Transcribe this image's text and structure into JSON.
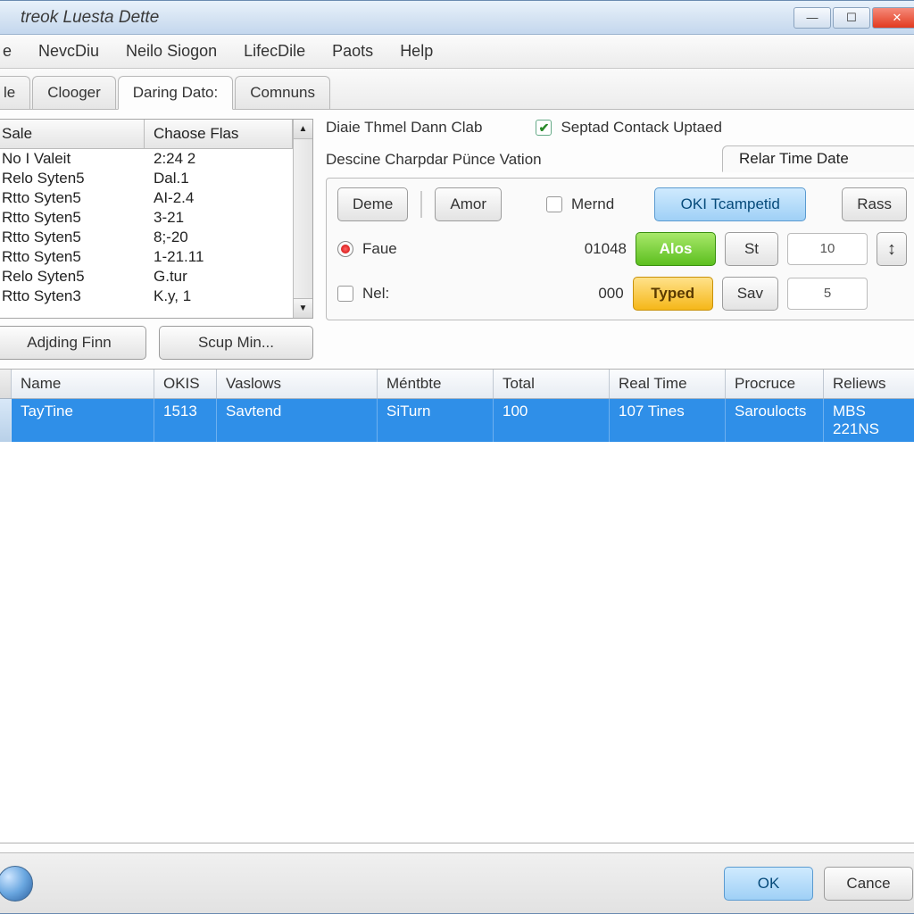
{
  "window": {
    "title": "treok Luesta Dette"
  },
  "menu": {
    "items": [
      "e",
      "NevcDiu",
      "Neilo Siogon",
      "LifecDile",
      "Paots",
      "Help"
    ]
  },
  "tabs": {
    "items": [
      "le",
      "Clooger",
      "Daring Dato:",
      "Comnuns"
    ],
    "active": 2
  },
  "leftList": {
    "headers": {
      "col1": "Sale",
      "col2": "Chaose Flas"
    },
    "rows": [
      {
        "c1": "No I Valeit",
        "c2": "2:24 2"
      },
      {
        "c1": "Relo Syten5",
        "c2": "Dal.1"
      },
      {
        "c1": "Rtto Syten5",
        "c2": "AI-2.4"
      },
      {
        "c1": "Rtto Syten5",
        "c2": "3-21"
      },
      {
        "c1": "Rtto Syten5",
        "c2": "8;-20"
      },
      {
        "c1": "Rtto Syten5",
        "c2": "1-21.11"
      },
      {
        "c1": "Relo Syten5",
        "c2": "G.tur"
      },
      {
        "c1": "Rtto Syten3",
        "c2": "K.y, 1"
      }
    ],
    "btn1": "Adjding Finn",
    "btn2": "Scup Min..."
  },
  "rightPanel": {
    "topLabel": "Diaie Thmel Dann Clab",
    "checkbox1": {
      "label": "Septad Contack Uptaed",
      "checked": true
    },
    "descLabel": "Descine Charpdar Pünce Vation",
    "panelTab": "Relar Time Date",
    "btnDeme": "Deme",
    "btnAmor": "Amor",
    "chkMernd": {
      "label": "Mernd",
      "checked": false
    },
    "btnOKI": "OKI Tcampetid",
    "btnRass": "Rass",
    "radioFaue": {
      "label": "Faue",
      "selected": true
    },
    "val1": "01048",
    "btnAlos": "Alos",
    "btnSt": "St",
    "spin1": "10",
    "chkNel": {
      "label": "Nel:",
      "checked": false
    },
    "val2": "000",
    "btnTyped": "Typed",
    "btnSav": "Sav",
    "spin2": "5"
  },
  "grid": {
    "headers": [
      "Name",
      "OKIS",
      "Vaslows",
      "Méntbte",
      "Total",
      "Real Time",
      "Procruce",
      "Reliews"
    ],
    "row": [
      "TayTine",
      "1513",
      "Savtend",
      "SiTurn",
      "100",
      "107 Tines",
      "Saroulocts",
      "MBS 221NS"
    ]
  },
  "footer": {
    "ok": "OK",
    "cancel": "Cance"
  }
}
